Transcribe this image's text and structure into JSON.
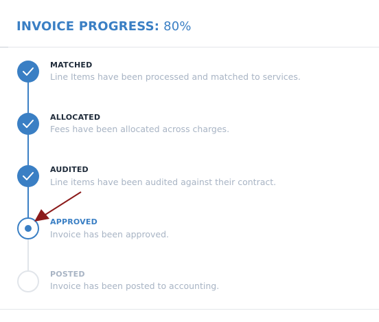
{
  "header": {
    "title": "INVOICE PROGRESS:",
    "value": "80%"
  },
  "progress_percent": 80,
  "steps": [
    {
      "label": "MATCHED",
      "description": "Line Items have been processed and matched to services.",
      "status": "complete"
    },
    {
      "label": "ALLOCATED",
      "description": "Fees have been allocated across charges.",
      "status": "complete"
    },
    {
      "label": "AUDITED",
      "description": "Line items have been audited against their contract.",
      "status": "complete"
    },
    {
      "label": "APPROVED",
      "description": "Invoice has been approved.",
      "status": "current"
    },
    {
      "label": "POSTED",
      "description": "Invoice has been posted to accounting.",
      "status": "pending"
    }
  ],
  "colors": {
    "accent": "#3a7fc4",
    "heading": "#1f2b3a",
    "muted": "#a8b4c4",
    "pending_line": "#e1e5ea",
    "annotation_arrow": "#8b1a1a"
  },
  "icons": {
    "complete": "check-icon",
    "current": "dot-icon",
    "annotation": "arrow-icon"
  }
}
